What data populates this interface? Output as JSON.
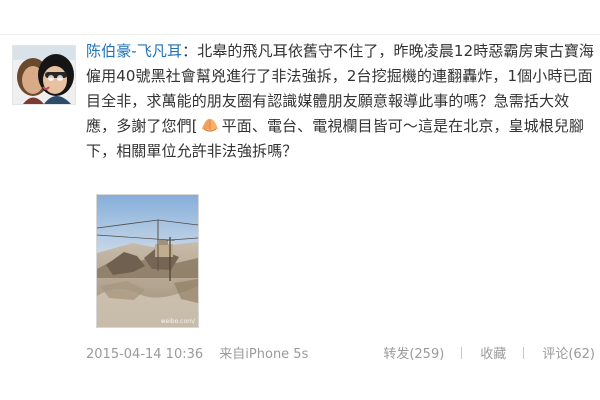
{
  "post": {
    "author": "陈伯豪-飞凡耳",
    "text_before_emoji": "：北皋的飛凡耳依舊守不住了，昨晚凌晨12時惡霸房東古寶海僱用40號黑社會幫兇進行了非法強拆，2台挖掘機的連翻轟炸，1個小時已面目全非，求萬能的朋友圈有認識媒體朋友願意報導此事的嗎？急需括大效應，多謝了您們[",
    "text_after_emoji": "平面、電台、電視欄目皆可～這是在北京，皇城根兒腳下，相關單位允許非法強拆嗎？",
    "emoji": "praying-hands-icon"
  },
  "photo": {
    "watermark": "weibo.com/"
  },
  "meta": {
    "time": "2015-04-14 10:36",
    "source": "来自iPhone 5s"
  },
  "actions": {
    "repost": "转发(259)",
    "favorite": "收藏",
    "comment": "评论(62)"
  },
  "colors": {
    "author_link": "#1f72b8",
    "body_text": "#333333",
    "meta_text": "#9a9a9a"
  }
}
